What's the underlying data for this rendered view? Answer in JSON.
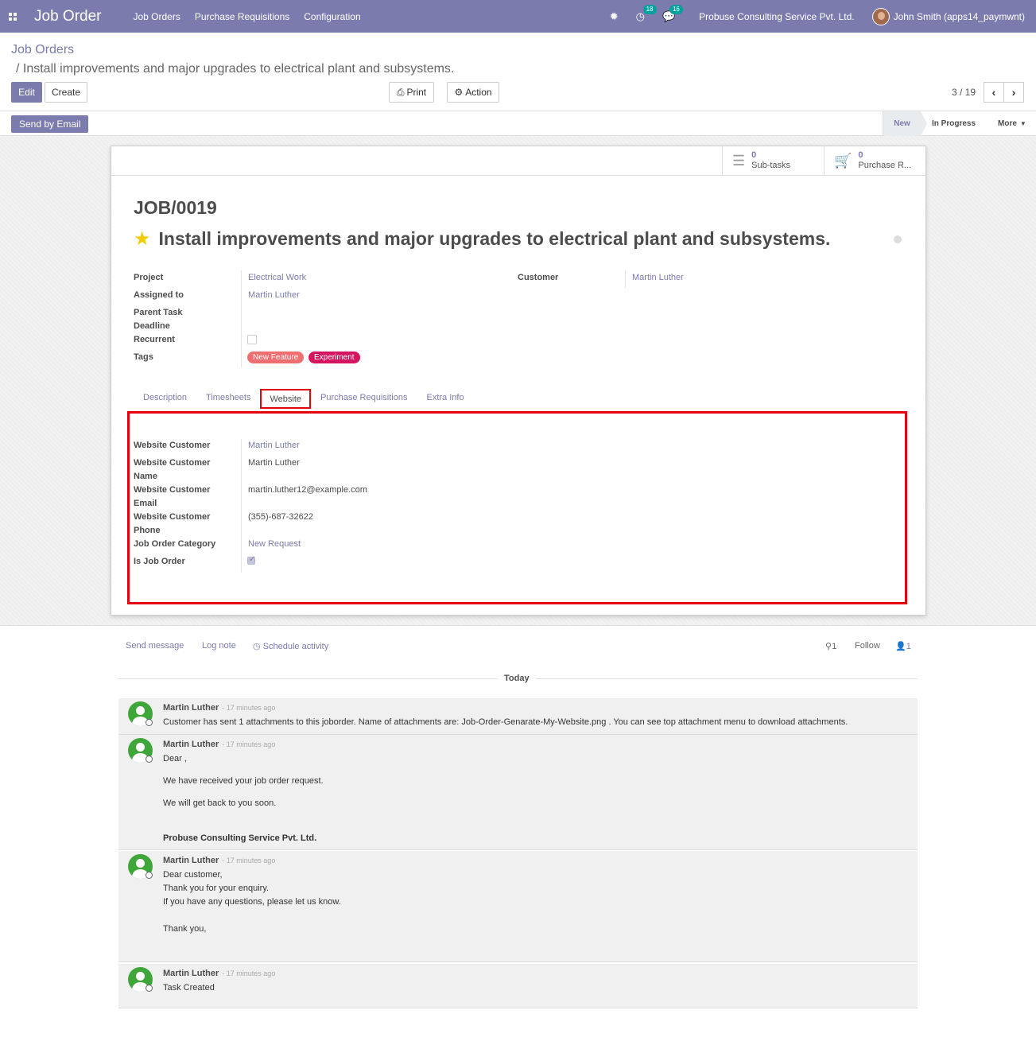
{
  "navbar": {
    "brand": "Job Order",
    "menu": [
      "Job Orders",
      "Purchase Requisitions",
      "Configuration"
    ],
    "activity_count": "18",
    "messages_count": "16",
    "company": "Probuse Consulting Service Pvt. Ltd.",
    "user": "John Smith (apps14_paymwnt)"
  },
  "breadcrumb": {
    "parent": "Job Orders",
    "current": "/ Install improvements and major upgrades to electrical plant and subsystems."
  },
  "toolbar": {
    "edit": "Edit",
    "create": "Create",
    "print": "Print",
    "action": "Action",
    "pager": "3 / 19",
    "send_email": "Send by Email"
  },
  "stages": [
    "New",
    "In Progress",
    "More"
  ],
  "stat_buttons": [
    {
      "count": "0",
      "label": "Sub-tasks"
    },
    {
      "count": "0",
      "label": "Purchase R..."
    }
  ],
  "record": {
    "ref": "JOB/0019",
    "title": "Install improvements and major upgrades to electrical plant and subsystems."
  },
  "fields": {
    "project_label": "Project",
    "project": "Electrical Work",
    "assigned_label": "Assigned to",
    "assigned": "Martin Luther",
    "parent_task_label": "Parent Task",
    "deadline_label": "Deadline",
    "recurrent_label": "Recurrent",
    "tags_label": "Tags",
    "tags": [
      {
        "name": "New Feature",
        "color": "#ef6e70"
      },
      {
        "name": "Experiment",
        "color": "#d6145f"
      }
    ],
    "customer_label": "Customer",
    "customer": "Martin Luther"
  },
  "tabs": [
    "Description",
    "Timesheets",
    "Website",
    "Purchase Requisitions",
    "Extra Info"
  ],
  "active_tab": "Website",
  "website": {
    "customer_label": "Website Customer",
    "customer": "Martin Luther",
    "name_label_1": "Website Customer",
    "name_label_2": "Name",
    "name": "Martin Luther",
    "email_label_1": "Website Customer",
    "email_label_2": "Email",
    "email": "martin.luther12@example.com",
    "phone_label_1": "Website Customer",
    "phone_label_2": "Phone",
    "phone": "(355)-687-32622",
    "category_label": "Job Order Category",
    "category": "New Request",
    "is_job_order_label": "Is Job Order"
  },
  "chatter": {
    "send_message": "Send message",
    "log_note": "Log note",
    "schedule_activity": "Schedule activity",
    "attachments": "1",
    "follow": "Follow",
    "followers": "1",
    "today": "Today",
    "messages": [
      {
        "author": "Martin Luther",
        "time": "- 17 minutes ago",
        "lines": [
          "Customer has sent 1 attachments to this joborder. Name of attachments are: Job-Order-Genarate-My-Website.png . You can see top attachment menu to download attachments."
        ]
      },
      {
        "author": "Martin Luther",
        "time": "- 17 minutes ago",
        "lines": [
          "Dear ,",
          "We have received your job order request.",
          "We will get back to you soon.",
          "Probuse Consulting Service Pvt. Ltd."
        ]
      },
      {
        "author": "Martin Luther",
        "time": "- 17 minutes ago",
        "lines": [
          "Dear customer,",
          "Thank you for your enquiry.",
          "If you have any questions, please let us know.",
          "Thank you,"
        ]
      },
      {
        "author": "Martin Luther",
        "time": "- 17 minutes ago",
        "lines": [
          "Task Created"
        ]
      }
    ]
  },
  "colors": {
    "brand": "#7c7bad",
    "highlight": "#e3000f",
    "avatar": "#3fa63a"
  }
}
